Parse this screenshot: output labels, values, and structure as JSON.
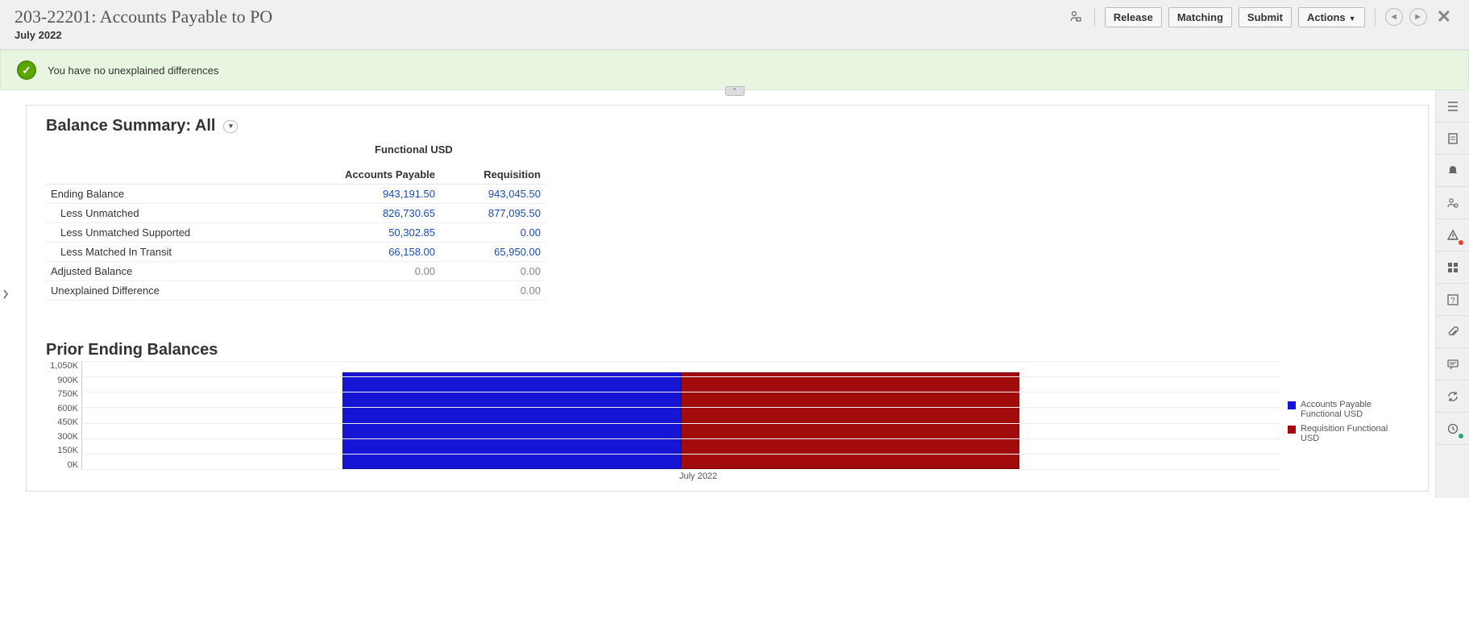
{
  "header": {
    "title": "203-22201: Accounts Payable to PO",
    "period": "July 2022",
    "buttons": {
      "release": "Release",
      "matching": "Matching",
      "submit": "Submit",
      "actions": "Actions"
    }
  },
  "banner": {
    "message": "You have no unexplained differences"
  },
  "summary": {
    "title_prefix": "Balance Summary: ",
    "title_scope": "All",
    "currency_label": "Functional USD",
    "sources": {
      "ap": "Accounts Payable",
      "req": "Requisition"
    },
    "rows": [
      {
        "label": "Ending Balance",
        "indent": 0,
        "ap": "943,191.50",
        "req": "943,045.50",
        "style": "link"
      },
      {
        "label": "Less Unmatched",
        "indent": 1,
        "ap": "826,730.65",
        "req": "877,095.50",
        "style": "link"
      },
      {
        "label": "Less Unmatched Supported",
        "indent": 1,
        "ap": "50,302.85",
        "req": "0.00",
        "style": "link"
      },
      {
        "label": "Less Matched In Transit",
        "indent": 1,
        "ap": "66,158.00",
        "req": "65,950.00",
        "style": "link"
      },
      {
        "label": "Adjusted Balance",
        "indent": 0,
        "ap": "0.00",
        "req": "0.00",
        "style": "muted"
      },
      {
        "label": "Unexplained Difference",
        "indent": 0,
        "ap": "",
        "req": "0.00",
        "style": "muted"
      }
    ]
  },
  "chart_title": "Prior Ending Balances",
  "chart_data": {
    "type": "bar",
    "categories": [
      "July 2022"
    ],
    "series": [
      {
        "name": "Accounts Payable Functional USD",
        "values": [
          943191.5
        ],
        "color": "#1615d6"
      },
      {
        "name": "Requisition Functional USD",
        "values": [
          943045.5
        ],
        "color": "#a10b0b"
      }
    ],
    "ylim": [
      0,
      1050000
    ],
    "yticks": [
      "1,050K",
      "900K",
      "750K",
      "600K",
      "450K",
      "300K",
      "150K",
      "0K"
    ],
    "xlabel": "",
    "ylabel": ""
  }
}
